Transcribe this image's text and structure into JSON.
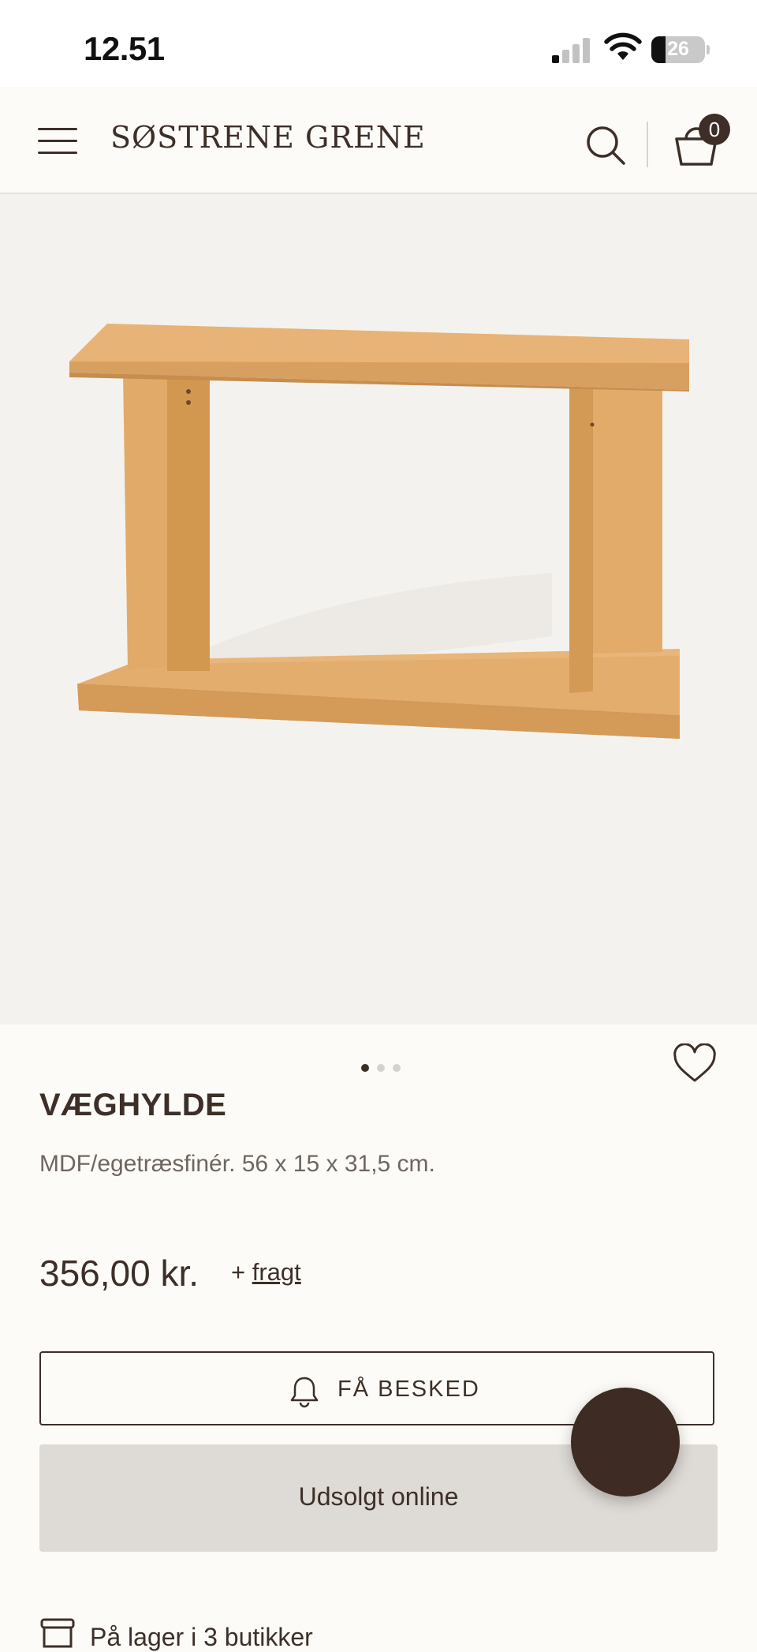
{
  "status_bar": {
    "time": "12.51",
    "battery": "26"
  },
  "header": {
    "logo": "SØSTRENE GRENE",
    "cart_count": "0",
    "icons": [
      "menu-icon",
      "search-icon",
      "basket-icon"
    ]
  },
  "product": {
    "image_index": 1,
    "image_count": 3,
    "title": "VÆGHYLDE",
    "description": "MDF/egetræsfinér. 56 x 15 x 31,5 cm.",
    "price": "356,00 kr.",
    "shipping_prefix": "+",
    "shipping_link": "fragt",
    "notify_label": "FÅ BESKED",
    "soldout_label": "Udsolgt online",
    "stock_text": "På lager i 3 butikker"
  },
  "colors": {
    "brand_brown": "#3d2f28",
    "background": "#fcfbf7",
    "image_bg": "#f4f2ee",
    "soldout_bg": "#dedad6",
    "wood": "#dba566"
  }
}
